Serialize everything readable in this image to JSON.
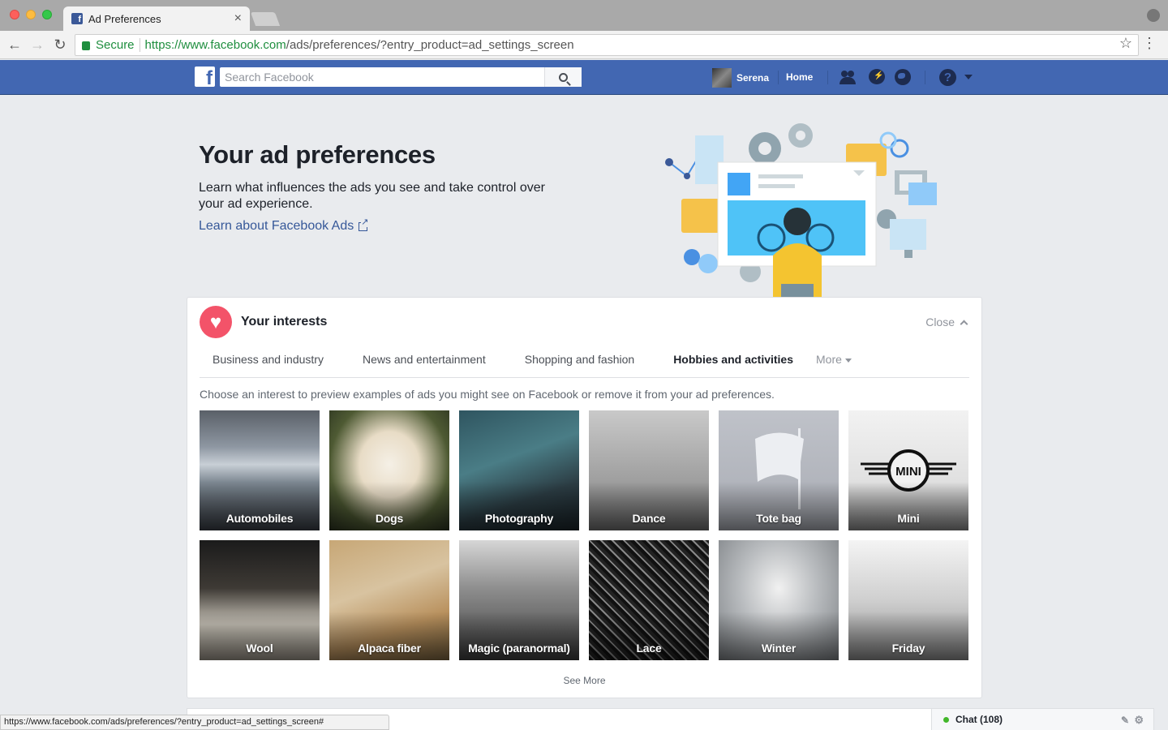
{
  "browser": {
    "tab_title": "Ad Preferences",
    "tab_close": "×",
    "secure_label": "Secure",
    "url_host": "https://www.facebook.com",
    "url_path": "/ads/preferences/?entry_product=ad_settings_screen",
    "status_url": "https://www.facebook.com/ads/preferences/?entry_product=ad_settings_screen#"
  },
  "fb_header": {
    "search_placeholder": "Search Facebook",
    "user_name": "Serena",
    "home_label": "Home",
    "colors": {
      "bar": "#4267b2"
    }
  },
  "hero": {
    "title": "Your ad preferences",
    "description": "Learn what influences the ads you see and take control over your ad experience.",
    "link": "Learn about Facebook Ads"
  },
  "interests": {
    "title": "Your interests",
    "close_label": "Close",
    "tabs": [
      {
        "label": "Business and industry",
        "active": false
      },
      {
        "label": "News and entertainment",
        "active": false
      },
      {
        "label": "Shopping and fashion",
        "active": false
      },
      {
        "label": "Hobbies and activities",
        "active": true
      }
    ],
    "more_label": "More",
    "instructions": "Choose an interest to preview examples of ads you might see on Facebook or remove it from your ad preferences.",
    "items": [
      {
        "label": "Automobiles",
        "bg": "bg-auto"
      },
      {
        "label": "Dogs",
        "bg": "bg-dogs"
      },
      {
        "label": "Photography",
        "bg": "bg-photo"
      },
      {
        "label": "Dance",
        "bg": "bg-dance"
      },
      {
        "label": "Tote bag",
        "bg": "bg-tote"
      },
      {
        "label": "Mini",
        "bg": "bg-mini"
      },
      {
        "label": "Wool",
        "bg": "bg-wool"
      },
      {
        "label": "Alpaca fiber",
        "bg": "bg-alpaca"
      },
      {
        "label": "Magic (paranormal)",
        "bg": "bg-magic"
      },
      {
        "label": "Lace",
        "bg": "bg-lace"
      },
      {
        "label": "Winter",
        "bg": "bg-winter"
      },
      {
        "label": "Friday",
        "bg": "bg-friday"
      }
    ],
    "see_more": "See More",
    "colors": {
      "heart": "#f35369"
    }
  },
  "chat": {
    "label": "Chat (108)"
  }
}
